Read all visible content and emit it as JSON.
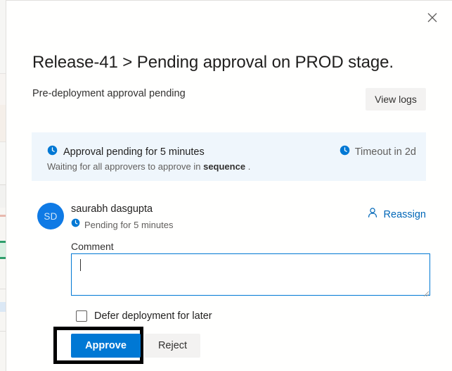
{
  "panel": {
    "close_icon": "close-icon",
    "title": "Release-41 > Pending approval on PROD stage.",
    "subtitle": "Pre-deployment approval pending",
    "view_logs_label": "View logs"
  },
  "banner": {
    "clock_icon": "clock-icon",
    "pending_text": "Approval pending for 5 minutes",
    "timeout_icon": "clock-icon",
    "timeout_text": "Timeout in 2d",
    "waiting_prefix": "Waiting for all approvers to approve in",
    "waiting_emphasis": "sequence",
    "waiting_suffix": "."
  },
  "approver": {
    "avatar_initials": "SD",
    "name": "saurabh dasgupta",
    "status_icon": "clock-icon",
    "status_text": "Pending for 5 minutes",
    "reassign_icon": "person-icon",
    "reassign_label": "Reassign"
  },
  "comment": {
    "label": "Comment",
    "value": "",
    "placeholder": ""
  },
  "defer": {
    "label": "Defer deployment for later",
    "checked": false
  },
  "actions": {
    "approve_label": "Approve",
    "reject_label": "Reject"
  },
  "colors": {
    "accent": "#0078d4",
    "link": "#0067b8",
    "banner_bg": "#eff6fc",
    "neutral_button": "#f3f2f1",
    "focus_outline": "#000000",
    "avatar_bg": "#0f7ae5"
  }
}
